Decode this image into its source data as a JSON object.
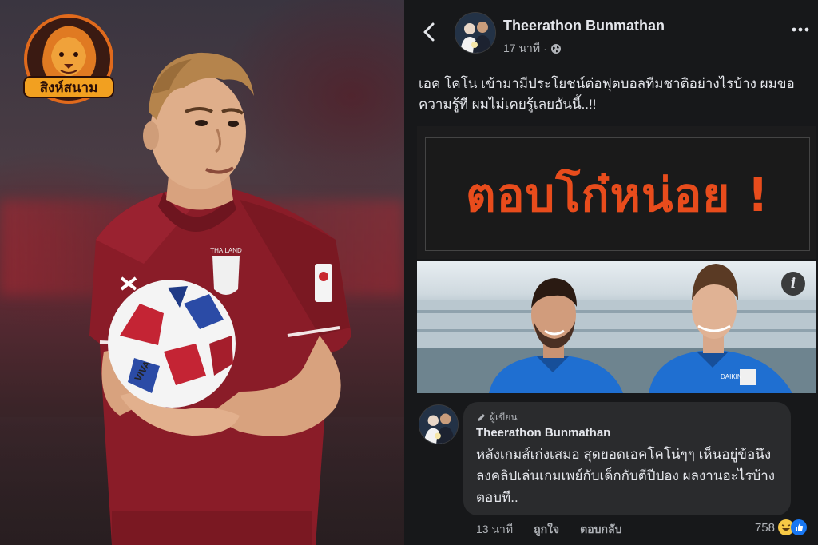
{
  "logo": {
    "text": "สิงห์สนาม"
  },
  "post": {
    "author": "Theerathon Bunmathan",
    "time": "17 นาที",
    "privacy_icon": "globe-icon",
    "text": "เอค โคโน เข้ามามีประโยชน์ต่อฟุตบอลทีมชาติอย่างไรบ้าง ผมขอความรู้ที ผมไม่เคยรู้เลยอันนี้..!!",
    "banner_text": "ตอบโก๋หน่อย !",
    "photo_info_label": "i"
  },
  "comment": {
    "author_badge": "ผู้เขียน",
    "author": "Theerathon Bunmathan",
    "text": "หลังเกมส์เก่งเสมอ  สุดยอดเอคโคโน่ๆๆ เห็นอยู่ข้อนึง ลงคลิปเล่นเกมเพย์กับเด็กกับตีปีปอง ผลงานอะไรบ้าง ตอบที..",
    "time": "13 นาที",
    "like_label": "ถูกใจ",
    "reply_label": "ตอบกลับ",
    "reaction_count": "758"
  },
  "colors": {
    "accent_orange": "#e84c1c",
    "fb_background": "#17181a",
    "bubble": "#2a2b2d",
    "jersey_red": "#8a1c28",
    "kit_blue": "#1f6fd1"
  }
}
